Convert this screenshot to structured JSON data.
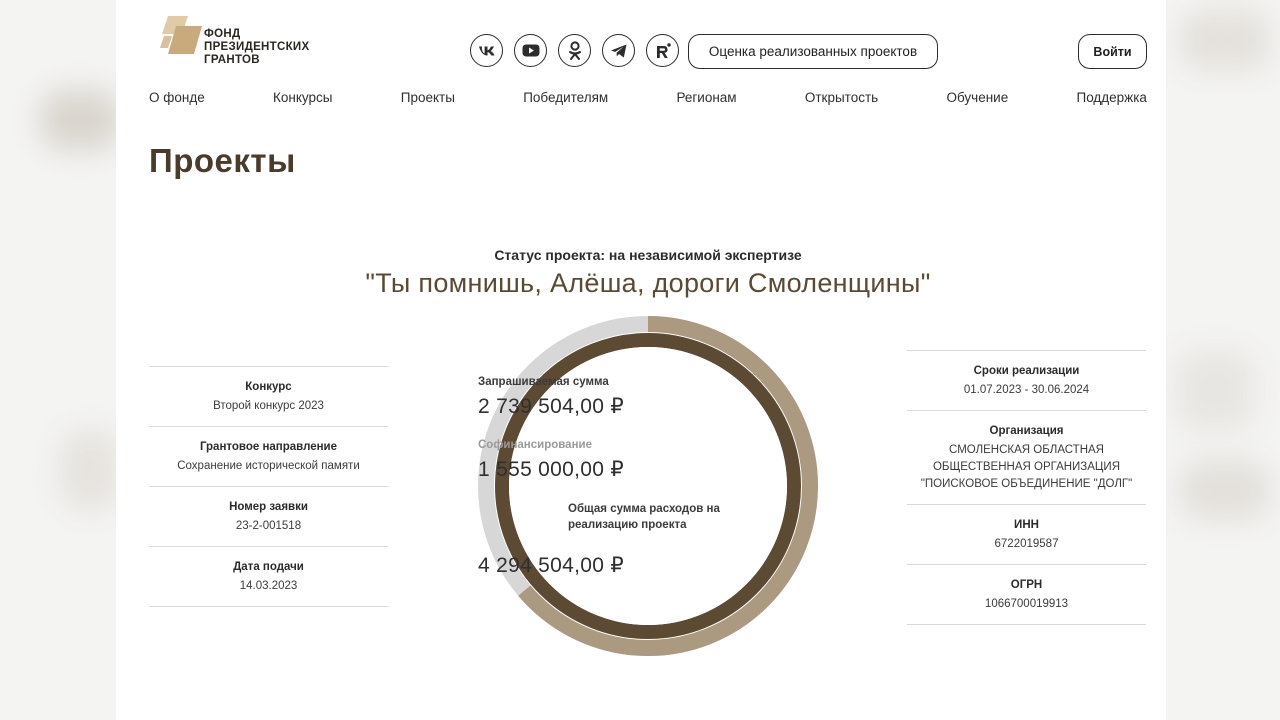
{
  "colors": {
    "brand_brown": "#5b4a33",
    "ring_dark": "#5c4a32",
    "ring_light": "#ab9a80",
    "ring_track": "#d7d7d7",
    "logo_tan": "#c8aa7c"
  },
  "logo": {
    "line1": "ФОНД",
    "line2": "ПРЕЗИДЕНТСКИХ",
    "line3": "ГРАНТОВ"
  },
  "socials": [
    {
      "icon": "vk-icon"
    },
    {
      "icon": "youtube-icon"
    },
    {
      "icon": "odnoklassniki-icon"
    },
    {
      "icon": "telegram-icon"
    },
    {
      "icon": "rutube-icon"
    }
  ],
  "header": {
    "rating_label": "Оценка реализованных проектов",
    "login_label": "Войти"
  },
  "nav": [
    {
      "label": "О фонде"
    },
    {
      "label": "Конкурсы"
    },
    {
      "label": "Проекты"
    },
    {
      "label": "Победителям"
    },
    {
      "label": "Регионам"
    },
    {
      "label": "Открытость"
    },
    {
      "label": "Обучение"
    },
    {
      "label": "Поддержка"
    }
  ],
  "page_title": "Проекты",
  "project": {
    "status": "Статус проекта: на независимой экспертизе",
    "title": "\"Ты помнишь, Алёша, дороги Смоленщины\""
  },
  "left_info": [
    {
      "label": "Конкурс",
      "value": "Второй конкурс 2023"
    },
    {
      "label": "Грантовое направление",
      "value": "Сохранение исторической памяти"
    },
    {
      "label": "Номер заявки",
      "value": "23-2-001518"
    },
    {
      "label": "Дата подачи",
      "value": "14.03.2023"
    }
  ],
  "right_info": [
    {
      "label": "Сроки реализации",
      "value": "01.07.2023 - 30.06.2024"
    },
    {
      "label": "Организация",
      "value": "СМОЛЕНСКАЯ ОБЛАСТНАЯ ОБЩЕСТВЕННАЯ ОРГАНИЗАЦИЯ \"ПОИСКОВОЕ ОБЪЕДИНЕНИЕ \"ДОЛГ\""
    },
    {
      "label": "ИНН",
      "value": "6722019587"
    },
    {
      "label": "ОГРН",
      "value": "1066700019913"
    }
  ],
  "budget": {
    "requested_label": "Запрашиваемая сумма",
    "requested_value": "2 739 504,00 ₽",
    "cofinancing_label": "Софинансирование",
    "cofinancing_value": "1 555 000,00 ₽",
    "total_label": "Общая сумма расходов на реализацию проекта",
    "total_value": "4 294 504,00 ₽",
    "requested_share": 0.638
  }
}
